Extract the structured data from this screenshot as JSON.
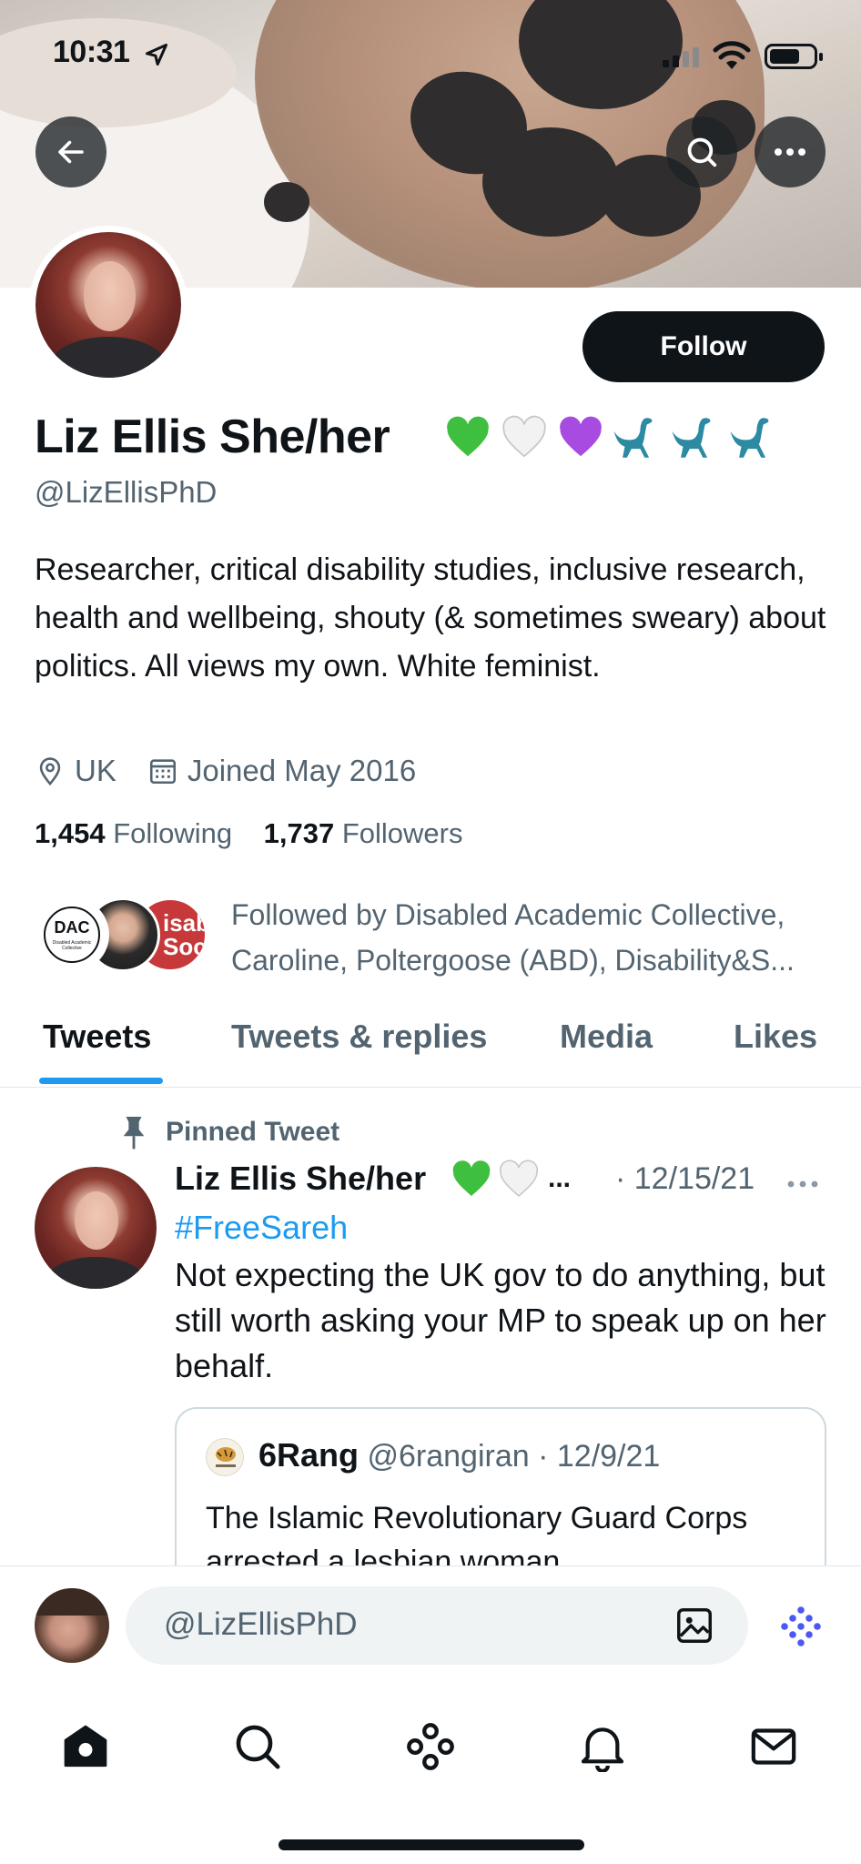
{
  "status_bar": {
    "time": "10:31"
  },
  "profile": {
    "display_name": "Liz Ellis She/her",
    "name_emojis": [
      "💚",
      "🤍",
      "💜",
      "🦕",
      "🦕",
      "🦕"
    ],
    "handle": "@LizEllisPhD",
    "bio": "Researcher, critical disability studies, inclusive research, health and wellbeing, shouty (& sometimes sweary) about politics. All views my own. White feminist.",
    "location": "UK",
    "joined": "Joined May 2016",
    "following_count": "1,454",
    "following_label": "Following",
    "followers_count": "1,737",
    "followers_label": "Followers",
    "followed_by_text": "Followed by Disabled Academic Collective, Caroline, Poltergoose (ABD), Disability&S...",
    "followed_by_avatars": [
      {
        "label": "DAC",
        "sublabel": "Disabled Academic Collective"
      },
      {
        "label": ""
      },
      {
        "label": "isab Soc"
      }
    ],
    "follow_button": "Follow"
  },
  "tabs": [
    {
      "label": "Tweets",
      "active": true
    },
    {
      "label": "Tweets & replies",
      "active": false
    },
    {
      "label": "Media",
      "active": false
    },
    {
      "label": "Likes",
      "active": false
    }
  ],
  "pinned_tweet": {
    "pinned_label": "Pinned Tweet",
    "author": "Liz Ellis She/her",
    "author_emojis": [
      "💚",
      "🤍"
    ],
    "truncation": "...",
    "date": "· 12/15/21",
    "hashtag": "#FreeSareh",
    "text": "Not expecting the UK gov to do anything, but still worth asking your MP to speak up on her behalf.",
    "quote": {
      "author": "6Rang",
      "handle": "@6rangiran",
      "date": "· 12/9/21",
      "text": "The Islamic Revolutionary Guard Corps arrested a lesbian woman"
    }
  },
  "reply_bar": {
    "placeholder": "@LizEllisPhD"
  },
  "colors": {
    "accent": "#1d9bf0",
    "text": "#0f1419",
    "secondary": "#536471",
    "follow_bg": "#0f1419",
    "sparkle": "#4b59f2"
  },
  "icons": {
    "back": "arrow-left-icon",
    "search": "search-icon",
    "more": "more-icon",
    "location": "location-pin-icon",
    "calendar": "calendar-icon",
    "pin": "pin-icon",
    "media": "image-icon",
    "sparkle": "sparkle-dots-icon",
    "nav": [
      "home-icon",
      "search-icon",
      "spaces-icon",
      "bell-icon",
      "mail-icon"
    ]
  }
}
